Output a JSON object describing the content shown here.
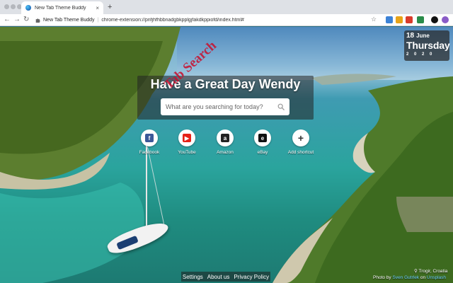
{
  "browser": {
    "tab_title": "New Tab Theme Buddy",
    "tab_close": "×",
    "new_tab": "+",
    "back": "←",
    "forward": "→",
    "reload": "↻",
    "page_name": "New Tab Theme Buddy",
    "url": "chrome-extension://pnfjhfhbbnadgbkpplgjfakdkppiofd/index.html#",
    "bookmark_star": "☆"
  },
  "date_widget": {
    "day": "18",
    "month": "June",
    "weekday": "Thursday",
    "year": "2 0 2 0"
  },
  "greeting": "Have a Great Day Wendy",
  "search": {
    "placeholder": "What are you searching for today?"
  },
  "watermark": "Tab Search",
  "shortcuts": [
    {
      "label": "Facebook",
      "glyph": "f",
      "color": "#3b5998"
    },
    {
      "label": "YouTube",
      "glyph": "▶",
      "color": "#e62117"
    },
    {
      "label": "Amazon",
      "glyph": "a",
      "color": "#222222"
    },
    {
      "label": "eBay",
      "glyph": "e",
      "color": "#111111"
    },
    {
      "label": "Add shortcut",
      "glyph": "+",
      "color": "#333333"
    }
  ],
  "footer": {
    "settings": "Settings",
    "about": "About us",
    "privacy": "Privacy Policy"
  },
  "location": "Trogir, Croatia",
  "credit": {
    "prefix": "Photo by",
    "author": "Sven Gutrlek",
    "middle": "on",
    "site": "Unsplash"
  },
  "colors": {
    "accent_link": "#6fd2ff",
    "panel": "rgba(35,35,35,0.55)"
  }
}
